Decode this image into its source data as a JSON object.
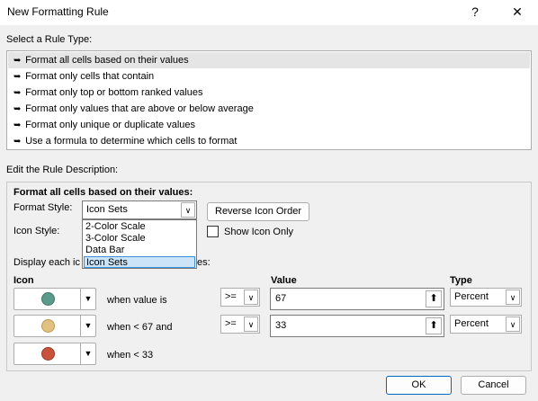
{
  "window": {
    "title": "New Formatting Rule",
    "help_glyph": "?",
    "close_glyph": "✕"
  },
  "rule_type": {
    "label": "Select a Rule Type:",
    "items": [
      "Format all cells based on their values",
      "Format only cells that contain",
      "Format only top or bottom ranked values",
      "Format only values that are above or below average",
      "Format only unique or duplicate values",
      "Use a formula to determine which cells to format"
    ],
    "selected_index": 0,
    "arrow_glyph": "➥"
  },
  "description": {
    "label": "Edit the Rule Description:",
    "heading": "Format all cells based on their values:",
    "format_style_label": "Format Style:",
    "format_style_value": "Icon Sets",
    "format_style_options": [
      "2-Color Scale",
      "3-Color Scale",
      "Data Bar",
      "Icon Sets"
    ],
    "reverse_button": "Reverse Icon Order",
    "icon_style_label": "Icon Style:",
    "show_icon_only_label": "Show Icon Only",
    "display_each_label": "Display each ic",
    "display_each_suffix": "es:",
    "col_icon": "Icon",
    "col_value": "Value",
    "col_type": "Type",
    "rows": [
      {
        "color": "#5b9a8b",
        "text": "when value is",
        "operator": ">=",
        "value": "67",
        "type": "Percent"
      },
      {
        "color": "#e2c080",
        "text": "when < 67 and",
        "operator": ">=",
        "value": "33",
        "type": "Percent"
      },
      {
        "color": "#c9533a",
        "text": "when < 33"
      }
    ]
  },
  "buttons": {
    "ok": "OK",
    "cancel": "Cancel"
  }
}
